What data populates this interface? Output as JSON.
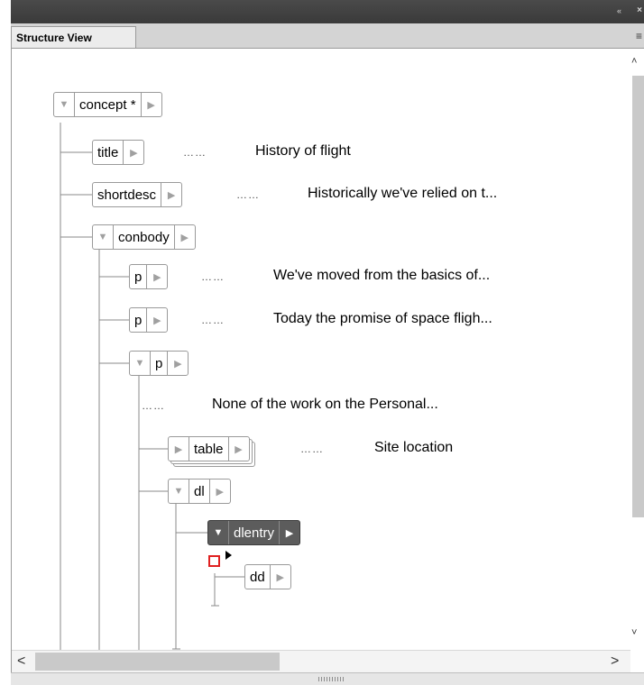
{
  "window": {
    "collapse_glyph": "«",
    "close_glyph": "×"
  },
  "tab": {
    "label": "Structure View"
  },
  "panel_menu_glyph": "≡",
  "nodes": {
    "concept": "concept *",
    "title": "title",
    "shortdesc": "shortdesc",
    "conbody": "conbody",
    "p1": "p",
    "p2": "p",
    "p3": "p",
    "table": "table",
    "dl": "dl",
    "dlentry": "dlentry",
    "dd": "dd"
  },
  "dots": "……",
  "texts": {
    "title": "History of flight",
    "shortdesc": "Historically we've relied on t...",
    "p1": "We've moved from the basics of...",
    "p2": "Today the promise of space fligh...",
    "p3_text": "None of the work on the Personal...",
    "table": "Site location"
  },
  "glyphs": {
    "expanded": "▼",
    "collapsed": "▶"
  },
  "scroll": {
    "up": "˄",
    "down": "˅",
    "left": "<",
    "right": ">"
  }
}
